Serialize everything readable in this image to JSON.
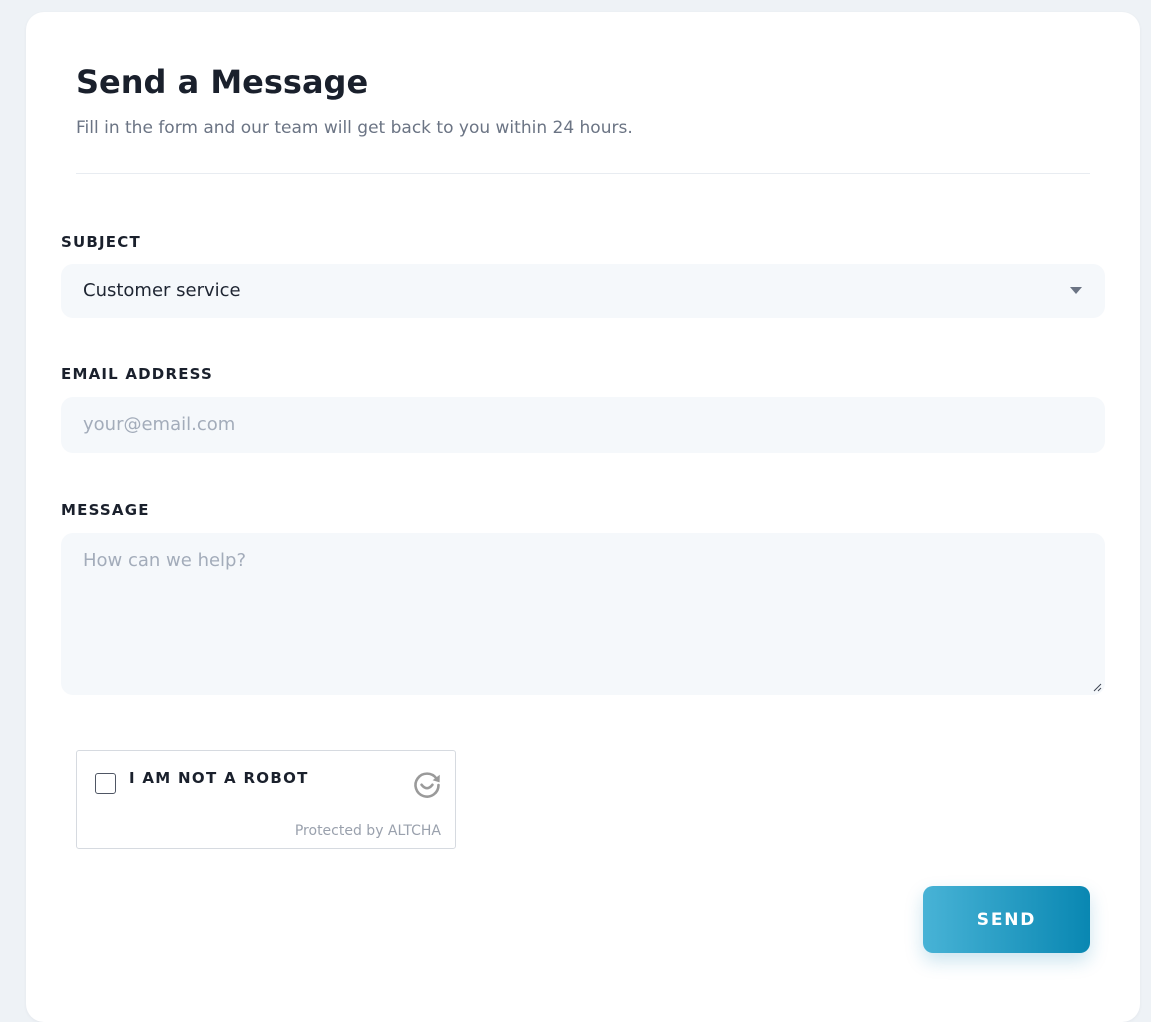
{
  "header": {
    "title": "Send a Message",
    "subtitle": "Fill in the form and our team will get back to you within 24 hours."
  },
  "form": {
    "subject": {
      "label": "SUBJECT",
      "selected": "Customer service"
    },
    "email": {
      "label": "EMAIL ADDRESS",
      "placeholder": "your@email.com"
    },
    "message": {
      "label": "MESSAGE",
      "placeholder": "How can we help?"
    },
    "captcha": {
      "label": "I AM NOT A ROBOT",
      "footer": "Protected by ALTCHA",
      "logo_icon": "altcha-refresh-icon"
    },
    "send_label": "SEND"
  },
  "colors": {
    "accent_start": "#48b3d6",
    "accent_end": "#0987b2",
    "field_background": "#f5f8fb",
    "page_background": "#eef2f6"
  }
}
